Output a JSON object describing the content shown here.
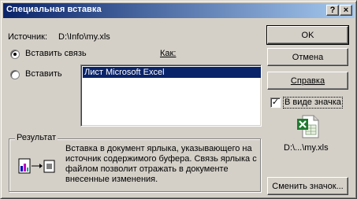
{
  "window": {
    "title": "Специальная вставка",
    "help_glyph": "?",
    "close_glyph": "×"
  },
  "source": {
    "label": "Источник:",
    "value": "D:\\Info\\my.xls"
  },
  "options": {
    "paste_link": "Вставить связь",
    "paste": "Вставить",
    "selected": "paste_link"
  },
  "as_label": "Как:",
  "list": {
    "items": [
      "Лист Microsoft Excel"
    ],
    "selected_index": 0
  },
  "buttons": {
    "ok": "OK",
    "cancel": "Отмена",
    "help": "Справка",
    "change_icon": "Сменить значок..."
  },
  "display_as_icon": {
    "label": "В виде значка",
    "checked": true,
    "check_glyph": "✓"
  },
  "icon_caption": "D:\\...\\my.xls",
  "result": {
    "legend": "Результат",
    "text": "Вставка в документ ярлыка, указывающего на источник содержимого буфера.  Связь ярлыка с файлом позволит отражать в документе внесенные изменения."
  },
  "colors": {
    "title_start": "#0a246a",
    "title_end": "#a6caf0",
    "selection": "#0a246a",
    "excel_green": "#1f7a30"
  }
}
